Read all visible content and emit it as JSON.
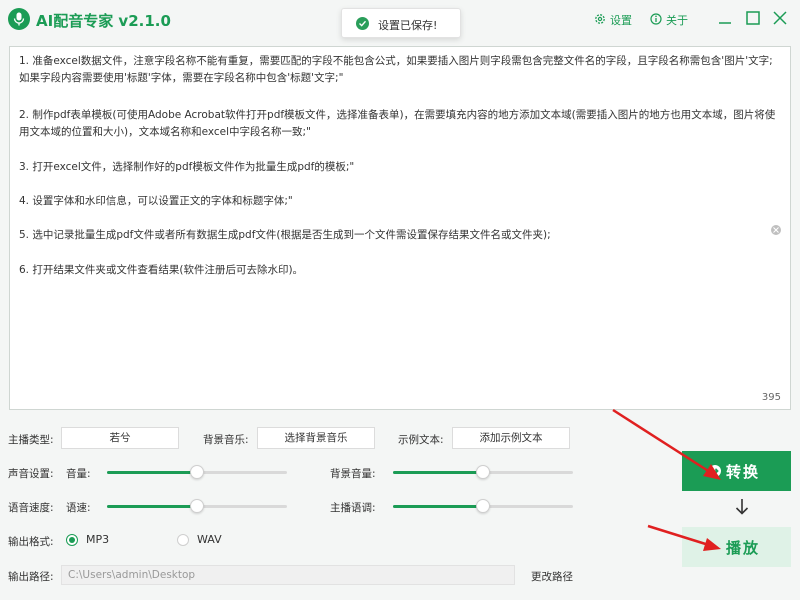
{
  "app": {
    "title": "AI配音专家 v2.1.0"
  },
  "toast": {
    "text": "设置已保存!"
  },
  "titlebar": {
    "settings_label": "设置",
    "about_label": "关于"
  },
  "editor": {
    "lines": [
      "1. 准备excel数据文件，注意字段名称不能有重复，需要匹配的字段不能包含公式，如果要插入图片则字段需包含完整文件名的字段，且字段名称需包含'图片'文字;如果字段内容需要使用'标题'字体，需要在字段名称中包含'标题'文字;\"",
      "2. 制作pdf表单模板(可使用Adobe Acrobat软件打开pdf模板文件，选择准备表单)，在需要填充内容的地方添加文本域(需要插入图片的地方也用文本域，图片将使用文本域的位置和大小)，文本域名称和excel中字段名称一致;\"",
      "3. 打开excel文件，选择制作好的pdf模板文件作为批量生成pdf的模板;\"",
      "4. 设置字体和水印信息，可以设置正文的字体和标题字体;\"",
      "5. 选中记录批量生成pdf文件或者所有数据生成pdf文件(根据是否生成到一个文件需设置保存结果文件名或文件夹);",
      "6. 打开结果文件夹或文件查看结果(软件注册后可去除水印)。"
    ],
    "char_count": "395"
  },
  "settings": {
    "anchor_type_label": "主播类型:",
    "anchor_type_value": "若兮",
    "bg_music_label": "背景音乐:",
    "bg_music_button": "选择背景音乐",
    "sample_text_label": "示例文本:",
    "sample_text_button": "添加示例文本",
    "voice_label": "声音设置:",
    "volume_label": "音量:",
    "volume_level": 0.5,
    "bg_volume_label": "背景音量:",
    "bg_volume_level": 0.5,
    "speed_label": "语音速度:",
    "speed_sub_label": "语速:",
    "speed_level": 0.5,
    "pitch_label": "主播语调:",
    "pitch_level": 0.5,
    "format_label": "输出格式:",
    "format_options": [
      "MP3",
      "WAV"
    ],
    "format_selected": "MP3",
    "path_label": "输出路径:",
    "path_value": "C:\\Users\\admin\\Desktop",
    "change_path_label": "更改路径"
  },
  "actions": {
    "convert_label": "转换",
    "play_label": "播放"
  },
  "colors": {
    "accent": "#1b9c55",
    "play_bg": "#dff2e7",
    "annotation_arrow": "#e02020"
  }
}
